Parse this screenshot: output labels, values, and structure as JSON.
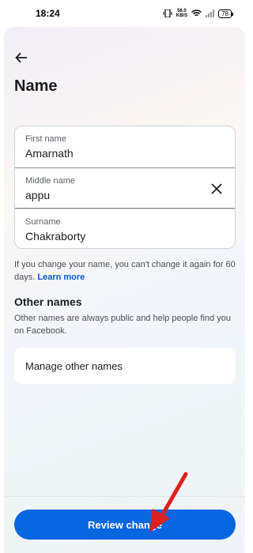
{
  "status_bar": {
    "time": "18:24",
    "net_speed_value": "56.0",
    "net_speed_unit": "KB/S",
    "battery": "78"
  },
  "header": {
    "title": "Name"
  },
  "form": {
    "first_name": {
      "label": "First name",
      "value": "Amarnath"
    },
    "middle_name": {
      "label": "Middle name",
      "value": "appu"
    },
    "surname": {
      "label": "Surname",
      "value": "Chakraborty"
    }
  },
  "helper": {
    "text": "If you change your name, you can't change it again for 60 days.",
    "link": "Learn more"
  },
  "other_names": {
    "title": "Other names",
    "description": "Other names are always public and help people find you on Facebook.",
    "manage_label": "Manage other names"
  },
  "footer": {
    "review_label": "Review change"
  },
  "colors": {
    "primary": "#0866e0",
    "annotation": "#e02020"
  }
}
